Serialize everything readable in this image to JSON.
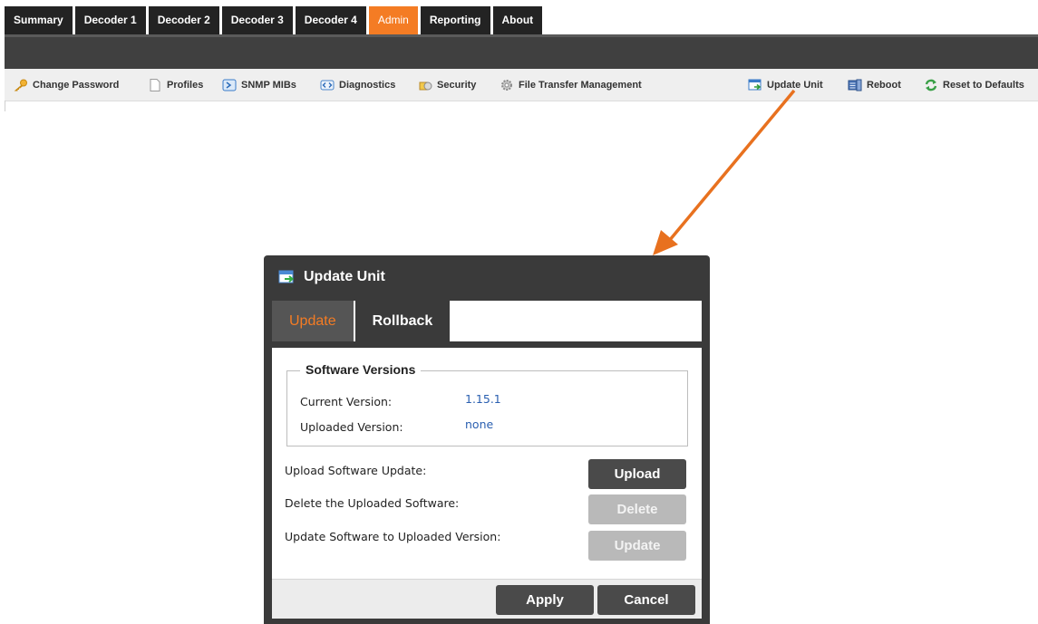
{
  "tabs": [
    {
      "label": "Summary",
      "active": false
    },
    {
      "label": "Decoder 1",
      "active": false
    },
    {
      "label": "Decoder 2",
      "active": false
    },
    {
      "label": "Decoder 3",
      "active": false
    },
    {
      "label": "Decoder 4",
      "active": false
    },
    {
      "label": "Admin",
      "active": true
    },
    {
      "label": "Reporting",
      "active": false
    },
    {
      "label": "About",
      "active": false
    }
  ],
  "toolbar": {
    "change_password": "Change Password",
    "profiles": "Profiles",
    "snmp_mibs": "SNMP MIBs",
    "diagnostics": "Diagnostics",
    "security": "Security",
    "file_transfer": "File Transfer Management",
    "update_unit": "Update Unit",
    "reboot": "Reboot",
    "reset_defaults": "Reset to Defaults"
  },
  "dialog": {
    "title": "Update Unit",
    "tabs": {
      "update": "Update",
      "rollback": "Rollback"
    },
    "versions": {
      "legend": "Software Versions",
      "current_label": "Current Version:",
      "current_value": "1.15.1",
      "uploaded_label": "Uploaded Version:",
      "uploaded_value": "none"
    },
    "actions": {
      "upload_label": "Upload Software Update:",
      "upload_button": "Upload",
      "delete_label": "Delete the Uploaded Software:",
      "delete_button": "Delete",
      "update_label": "Update Software to Uploaded Version:",
      "update_button": "Update"
    },
    "footer": {
      "apply": "Apply",
      "cancel": "Cancel"
    }
  },
  "colors": {
    "accent": "#f47c24",
    "tab_bg": "#232323",
    "link_blue": "#2a5fb0",
    "dialog_bg": "#3a3a3a"
  }
}
